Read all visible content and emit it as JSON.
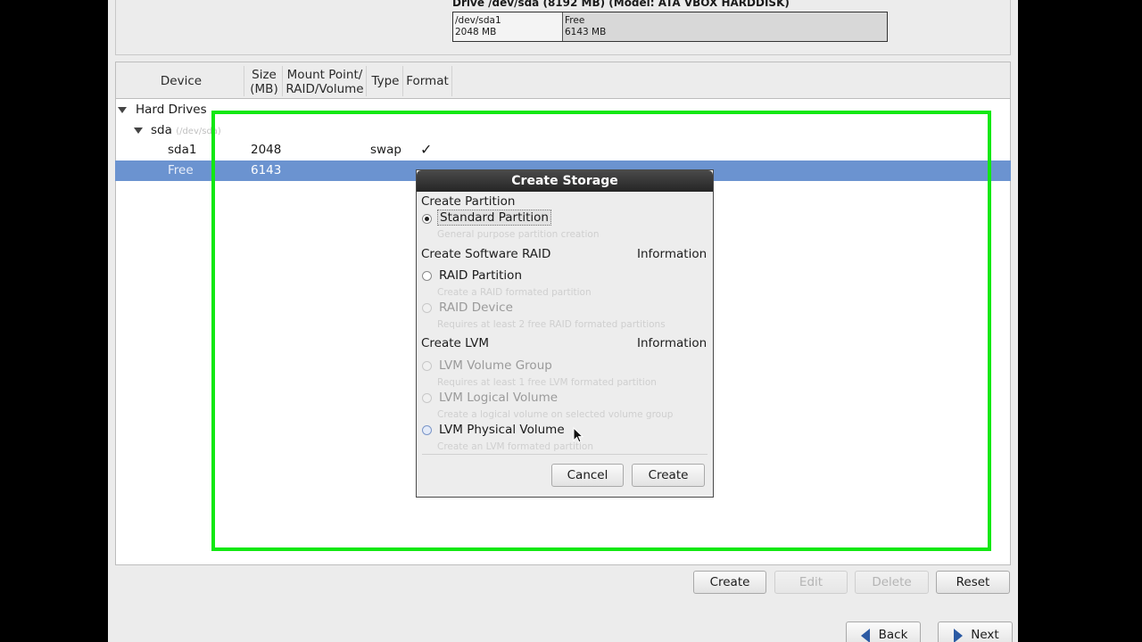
{
  "drive": {
    "title": "Drive /dev/sda (8192 MB) (Model: ATA VBOX HARDDISK)",
    "segments": [
      {
        "name": "/dev/sda1",
        "size": "2048 MB"
      },
      {
        "name": "Free",
        "size": "6143 MB"
      }
    ]
  },
  "table": {
    "headers": {
      "device": "Device",
      "size_l1": "Size",
      "size_l2": "(MB)",
      "mount_l1": "Mount Point/",
      "mount_l2": "RAID/Volume",
      "type": "Type",
      "format": "Format"
    },
    "tree": {
      "hard_drives": "Hard Drives",
      "sda": "sda",
      "sda_path": "(/dev/sda)"
    },
    "rows": [
      {
        "device": "sda1",
        "size": "2048",
        "type": "swap",
        "format": "✓"
      },
      {
        "device": "Free",
        "size": "6143",
        "type": "",
        "format": ""
      }
    ]
  },
  "dialog": {
    "title": "Create Storage",
    "section_partition": "Create Partition",
    "standard_partition": "Standard Partition",
    "standard_desc": "General purpose partition creation",
    "section_raid": "Create Software RAID",
    "info_raid": "Information",
    "raid_partition": "RAID Partition",
    "raid_partition_desc": "Create a RAID formated partition",
    "raid_device": "RAID Device",
    "raid_device_desc": "Requires at least 2 free RAID formated partitions",
    "section_lvm": "Create LVM",
    "info_lvm": "Information",
    "lvm_vg": "LVM Volume Group",
    "lvm_vg_desc": "Requires at least 1 free LVM formated partition",
    "lvm_lv": "LVM Logical Volume",
    "lvm_lv_desc": "Create a logical volume on selected volume group",
    "lvm_pv": "LVM Physical Volume",
    "lvm_pv_desc": "Create an LVM formated partition",
    "cancel": "Cancel",
    "create": "Create",
    "selected_option": "Standard Partition"
  },
  "actions": {
    "create": "Create",
    "edit": "Edit",
    "delete": "Delete",
    "reset": "Reset"
  },
  "nav": {
    "back": "Back",
    "next": "Next"
  },
  "colors": {
    "selection": "#6b93d0",
    "highlight_box": "#12e812",
    "dialog_title_bg": "#2e2e2e"
  },
  "icons": {
    "back": "arrow-left-icon",
    "next": "arrow-right-icon",
    "expand": "triangle-down-icon",
    "format_check": "check-icon",
    "pointer": "mouse-cursor-icon"
  }
}
